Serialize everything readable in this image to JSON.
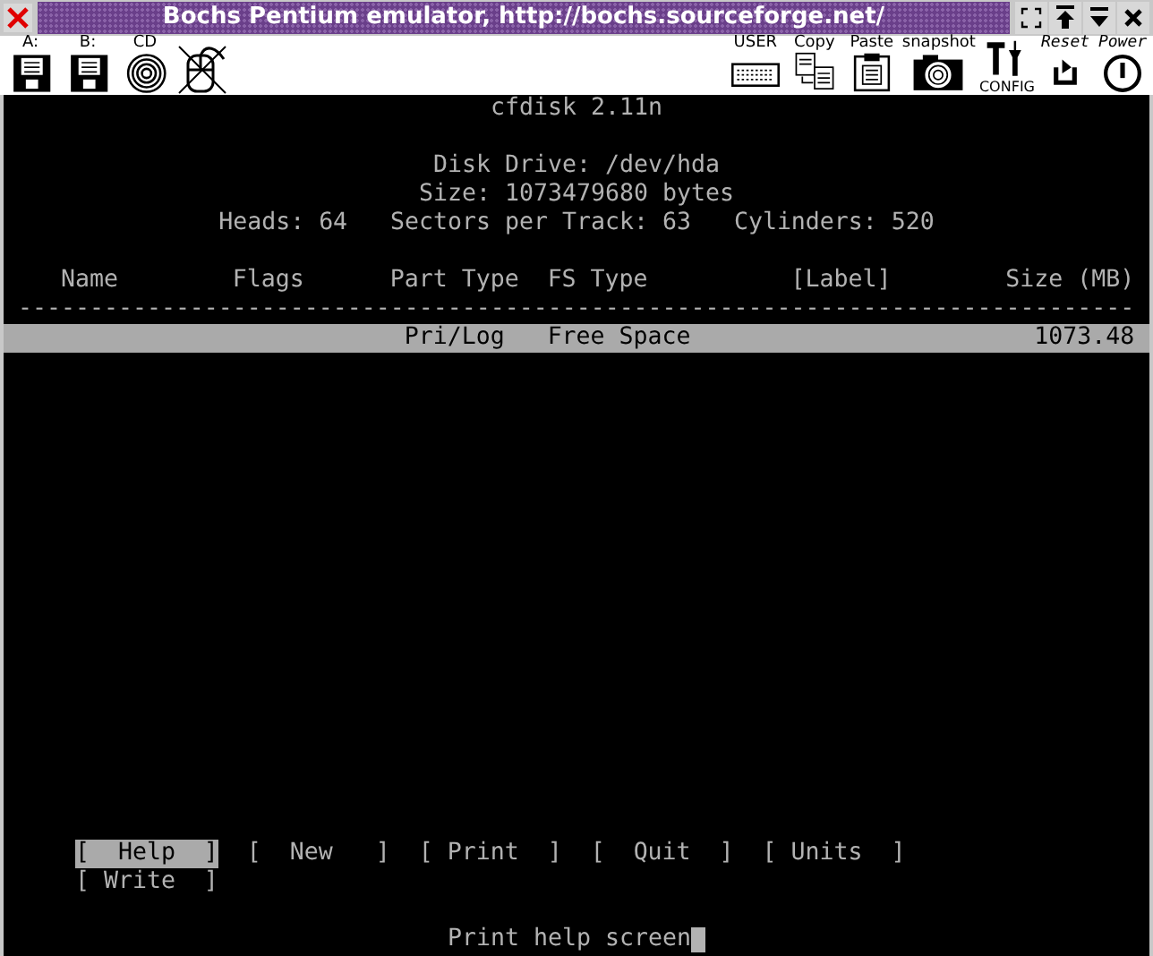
{
  "window": {
    "title": "Bochs Pentium emulator, http://bochs.sourceforge.net/"
  },
  "toolbar": {
    "left": [
      {
        "kind": "floppy",
        "label": "A:",
        "on": true
      },
      {
        "kind": "floppy",
        "label": "B:",
        "on": true
      },
      {
        "kind": "cdrom",
        "label": "CD",
        "on": true
      },
      {
        "kind": "mouse",
        "on": false
      }
    ],
    "right": [
      {
        "kind": "keyboard",
        "label": "USER"
      },
      {
        "kind": "copy",
        "label": "Copy"
      },
      {
        "kind": "paste",
        "label": "Paste"
      },
      {
        "kind": "camera",
        "label": "snapshot"
      },
      {
        "kind": "config",
        "label": "CONFIG"
      },
      {
        "kind": "reset",
        "label": "Reset"
      },
      {
        "kind": "power",
        "label": "Power"
      }
    ]
  },
  "screen": {
    "title": "cfdisk 2.11n",
    "disk_drive": "Disk Drive: /dev/hda",
    "size": "Size: 1073479680 bytes",
    "geometry": [
      "Heads: 64",
      "Sectors per Track: 63",
      "Cylinders: 520"
    ],
    "table": {
      "columns": [
        "Name",
        "Flags",
        "Part Type",
        "FS Type",
        "[Label]",
        "Size (MB)"
      ],
      "separator": "------------------------------------------------------------------------------",
      "rows": [
        {
          "selected": true,
          "cells": [
            "",
            "",
            "Pri/Log",
            "Free Space",
            "",
            "1073.48"
          ]
        }
      ]
    },
    "menu": [
      {
        "label": "[  Help  ]",
        "selected": true
      },
      {
        "label": "[  New   ]",
        "selected": false
      },
      {
        "label": "[ Print  ]",
        "selected": false
      },
      {
        "label": "[  Quit  ]",
        "selected": false
      },
      {
        "label": "[ Units  ]",
        "selected": false
      },
      {
        "label": "[ Write  ]",
        "selected": false
      }
    ],
    "status": "Print help screen"
  }
}
